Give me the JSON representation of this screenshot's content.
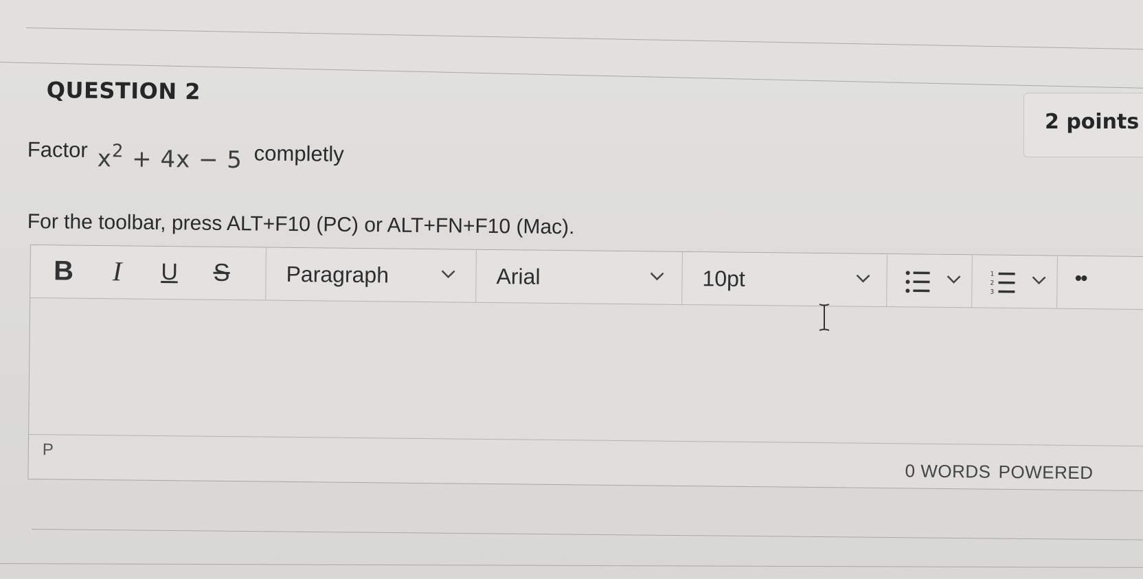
{
  "question": {
    "title": "QUESTION 2",
    "points": "2 points",
    "prompt_prefix": "Factor",
    "math": {
      "base": "x",
      "exponent": "2",
      "rest": " + 4x − 5"
    },
    "prompt_suffix": "completly"
  },
  "editor": {
    "toolbar_hint": "For the toolbar, press ALT+F10 (PC) or ALT+FN+F10 (Mac).",
    "toolbar": {
      "bold_label": "B",
      "italic_label": "I",
      "underline_label": "U",
      "strike_label": "S",
      "block_format": "Paragraph",
      "font_family": "Arial",
      "font_size": "10pt",
      "more_label": "••"
    },
    "status": {
      "path": "P",
      "word_count": "0 WORDS",
      "powered_by": "POWERED"
    }
  },
  "icons": {
    "bullet_list": "bullet-list-icon",
    "numbered_list": "numbered-list-icon",
    "chevron": "chevron-down-icon",
    "cursor": "text-cursor-icon"
  },
  "colors": {
    "background": "#e0dfdd",
    "text": "#2a2a2a",
    "border": "#a8a7a5"
  }
}
